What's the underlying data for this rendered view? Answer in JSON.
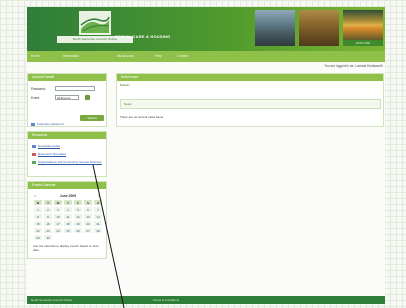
{
  "header": {
    "logo_strip": "North Somerset Council Online",
    "site_title": "SOCIAL CARE & HOUSING",
    "photo_caption": "EXPLORE"
  },
  "nav": {
    "items": [
      "Home",
      "Information",
      "My Account",
      "Help",
      "Contact"
    ]
  },
  "login_status": "You are logged in as: Lucinda Holdsworth",
  "login_box": {
    "title": "Account Details",
    "password_label": "Password:",
    "password_value": "",
    "event_label": "Event:",
    "event_value": "All Events",
    "login_label": "Submit",
    "forgot_label": "Forgotten password"
  },
  "resources_box": {
    "title": "Resources",
    "items": [
      "Homecare Index",
      "Document Templates",
      "Organisations and Community Groups Directory"
    ]
  },
  "events_box": {
    "title": "Events Calendar",
    "month": "June 2009",
    "prev": "«",
    "next": "»",
    "day_headers": [
      "M",
      "T",
      "W",
      "T",
      "F",
      "S",
      "S"
    ],
    "days": [
      "1",
      "2",
      "3",
      "4",
      "5",
      "6",
      "7",
      "8",
      "9",
      "10",
      "11",
      "12",
      "13",
      "14",
      "15",
      "16",
      "17",
      "18",
      "19",
      "20",
      "21",
      "22",
      "23",
      "24",
      "25",
      "26",
      "27",
      "28",
      "29",
      "30"
    ],
    "note": "Use the calendar to display events based on start date."
  },
  "main": {
    "title": "Noticeboard",
    "subtitle": "Bulletin",
    "news_bar_label": "News",
    "news_text": "There are no current news items"
  },
  "footer": {
    "links": [
      "North Somerset Council Online",
      "Terms & Conditions"
    ]
  },
  "colors": {
    "header_green": "#2f7d3a",
    "nav_green": "#8fc04a",
    "link_blue": "#2a5aa0"
  }
}
